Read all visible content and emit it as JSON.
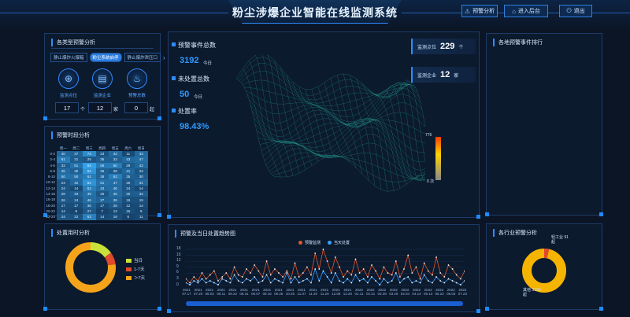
{
  "header": {
    "title": "粉尘涉爆企业智能在线监测系统",
    "buttons": [
      {
        "label": "预警分析",
        "icon": "warning-icon"
      },
      {
        "label": "进入后台",
        "icon": "home-icon"
      },
      {
        "label": "退出",
        "icon": "power-icon"
      }
    ]
  },
  "warn_analysis": {
    "title": "各类型预警分析",
    "tabs": [
      "静止爆炸火爆箱",
      "粉尘系统启停",
      "静止爆炸泄压口"
    ],
    "active_tab": 1,
    "kpis": [
      {
        "label": "监测点位",
        "value": "17",
        "unit": "个",
        "icon": "target-icon"
      },
      {
        "label": "监测企业",
        "value": "12",
        "unit": "家",
        "icon": "document-icon"
      },
      {
        "label": "预警总数",
        "value": "0",
        "unit": "起",
        "icon": "alarm-icon"
      }
    ]
  },
  "time_analysis": {
    "title": "预警时段分析",
    "days": [
      "周一",
      "周二",
      "周三",
      "周四",
      "周五",
      "周六",
      "周日"
    ],
    "slots": [
      "0-2",
      "2-4",
      "4-6",
      "6-8",
      "8-10",
      "10-12",
      "12-14",
      "14-16",
      "16-18",
      "18-20",
      "20-22",
      "22-24"
    ],
    "values": [
      [
        40,
        37,
        74,
        23,
        44,
        11,
        43
      ],
      [
        61,
        31,
        25,
        35,
        33,
        43,
        47
      ],
      [
        32,
        51,
        94,
        58,
        60,
        29,
        42
      ],
      [
        45,
        35,
        84,
        36,
        28,
        41,
        24
      ],
      [
        50,
        50,
        61,
        38,
        62,
        35,
        30
      ],
      [
        24,
        42,
        82,
        51,
        47,
        26,
        41
      ],
      [
        24,
        14,
        62,
        43,
        46,
        24,
        14
      ],
      [
        28,
        33,
        49,
        25,
        45,
        30,
        32
      ],
      [
        26,
        24,
        46,
        37,
        39,
        19,
        19
      ],
      [
        17,
        17,
        35,
        17,
        28,
        12,
        14
      ],
      [
        14,
        8,
        27,
        7,
        13,
        16,
        9
      ],
      [
        24,
        22,
        63,
        14,
        18,
        6,
        11
      ]
    ]
  },
  "duration_analysis": {
    "title": "处置用时分析",
    "legend": [
      {
        "label": "当日",
        "color": "#c8e03a"
      },
      {
        "label": "1-7天",
        "color": "#e0492b"
      },
      {
        "label": "＞7天",
        "color": "#f5a31a"
      }
    ],
    "values": [
      15,
      8,
      77
    ]
  },
  "center": {
    "stats": [
      {
        "label": "预警事件总数",
        "value": "3192",
        "unit": "今日"
      },
      {
        "label": "未处置总数",
        "value": "50",
        "unit": "今日"
      },
      {
        "label": "处置率",
        "value": "98.43%",
        "unit": ""
      }
    ],
    "counters": [
      {
        "label": "监测点位",
        "value": "229",
        "unit": "个"
      },
      {
        "label": "监测企业",
        "value": "12",
        "unit": "家"
      }
    ],
    "scale_max": "776",
    "scale_min": "0 次"
  },
  "trend": {
    "title": "预警及当日处置趋势图",
    "legend": [
      {
        "label": "预警监测",
        "color": "#e0582b"
      },
      {
        "label": "当天处置",
        "color": "#3aa0ff"
      }
    ],
    "y_ticks": [
      "18",
      "15",
      "12",
      "9",
      "6",
      "3",
      "0"
    ]
  },
  "event_rank": {
    "title": "各地预警事件排行"
  },
  "industry": {
    "title": "各行业预警分析",
    "labels": [
      "轻工业 91起",
      "其他 3100起"
    ]
  },
  "chart_data": {
    "type": "line",
    "title": "预警及当日处置趋势图",
    "ylim": [
      0,
      18
    ],
    "x": [
      "2021 07.17",
      "2021 07.25",
      "2021 08.03",
      "2021 08.11",
      "2021 08.22",
      "2021 08.31",
      "2021 09.07",
      "2021 09.16",
      "2021 09.25",
      "2021 10.25",
      "2021 11.07",
      "2021 11.20",
      "2021 11.29",
      "2021 12.08",
      "2021 12.20",
      "2022 01.11",
      "2022 02.21",
      "2022 03.28",
      "2022 03.26",
      "2022 04.04",
      "2022 04.13",
      "2022 05.13",
      "2022 05.22",
      "2022 06.03",
      "2022 07.23"
    ],
    "series": [
      {
        "name": "预警监测",
        "values": [
          3,
          1,
          4,
          2,
          6,
          3,
          5,
          7,
          2,
          4,
          6,
          3,
          9,
          5,
          4,
          8,
          6,
          10,
          7,
          4,
          12,
          5,
          8,
          6,
          4,
          7,
          3,
          11,
          4,
          6,
          9,
          5,
          16,
          8,
          18,
          12,
          6,
          14,
          9,
          4,
          7,
          5,
          13,
          6,
          8,
          4,
          10,
          7,
          3,
          9,
          6,
          5,
          12,
          4,
          8,
          15,
          6,
          9,
          3,
          11,
          7,
          5,
          14,
          6,
          4,
          10,
          8,
          5,
          3,
          7
        ]
      },
      {
        "name": "当天处置",
        "values": [
          1,
          0,
          2,
          1,
          3,
          1,
          2,
          1,
          0,
          3,
          2,
          1,
          5,
          2,
          1,
          3,
          2,
          4,
          1,
          2,
          5,
          1,
          3,
          2,
          1,
          6,
          1,
          4,
          1,
          2,
          3,
          1,
          8,
          2,
          7,
          4,
          1,
          6,
          2,
          1,
          3,
          1,
          5,
          2,
          3,
          1,
          4,
          2,
          0,
          3,
          1,
          2,
          6,
          1,
          3,
          4,
          1,
          2,
          1,
          5,
          2,
          1,
          4,
          2,
          1,
          3,
          2,
          1,
          0,
          2
        ]
      }
    ]
  }
}
